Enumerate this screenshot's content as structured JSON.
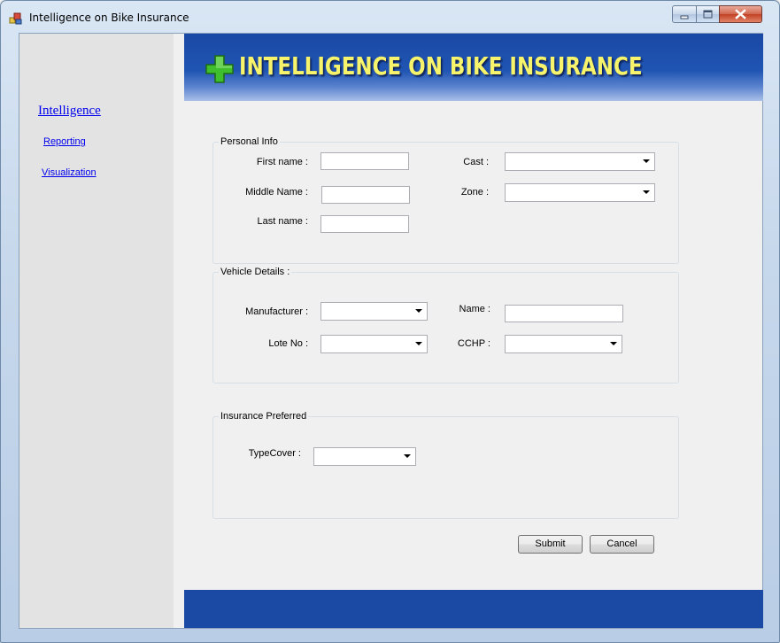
{
  "window": {
    "title": "Intelligence on Bike Insurance"
  },
  "sidebar": {
    "heading": "Intelligence",
    "items": [
      {
        "label": "Reporting"
      },
      {
        "label": "Visualization"
      }
    ]
  },
  "banner": {
    "title": "INTELLIGENCE ON BIKE INSURANCE",
    "icon": "green-plus-icon"
  },
  "personal_info": {
    "group_label": "Personal Info",
    "first_name_label": "First name :",
    "first_name_value": "",
    "middle_name_label": "Middle Name :",
    "middle_name_value": "",
    "last_name_label": "Last name :",
    "last_name_value": "",
    "cast_label": "Cast :",
    "cast_value": "",
    "zone_label": "Zone :",
    "zone_value": ""
  },
  "vehicle_details": {
    "group_label": "Vehicle Details :",
    "manufacturer_label": "Manufacturer :",
    "manufacturer_value": "",
    "lote_no_label": "Lote No :",
    "lote_no_value": "",
    "name_label": "Name :",
    "name_value": "",
    "cchp_label": "CCHP :",
    "cchp_value": ""
  },
  "insurance": {
    "group_label": "Insurance Preferred",
    "typecover_label": "TypeCover :",
    "typecover_value": ""
  },
  "actions": {
    "submit_label": "Submit",
    "cancel_label": "Cancel"
  },
  "colors": {
    "banner_blue": "#1b4aa5",
    "banner_text": "#f7f36a",
    "link": "#0000ee"
  }
}
